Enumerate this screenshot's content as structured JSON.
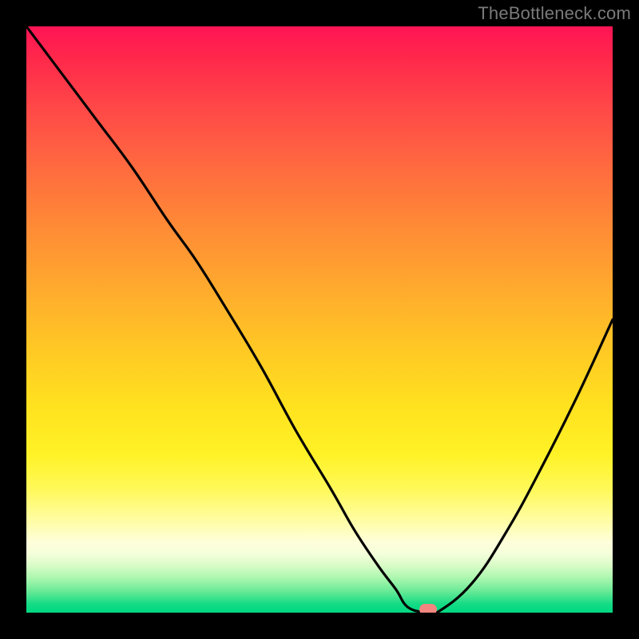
{
  "watermark": "TheBottleneck.com",
  "chart_data": {
    "type": "line",
    "title": "",
    "xlabel": "",
    "ylabel": "",
    "xlim": [
      0,
      100
    ],
    "ylim": [
      0,
      100
    ],
    "grid": false,
    "legend": false,
    "x": [
      0,
      6,
      12,
      18,
      24,
      29,
      34,
      40,
      46,
      52,
      56,
      60,
      63,
      65,
      68,
      70,
      76,
      82,
      88,
      94,
      100
    ],
    "values": [
      100,
      92,
      84,
      76,
      67,
      60,
      52,
      42,
      31,
      21,
      14,
      8,
      4,
      1,
      0,
      0,
      5,
      14,
      25,
      37,
      50
    ],
    "marker": {
      "x": 68.5,
      "y": 0.6
    },
    "colors": {
      "curve": "#000000",
      "marker": "#f2857f",
      "gradient_top": "#ff1455",
      "gradient_bottom": "#05d882"
    }
  }
}
